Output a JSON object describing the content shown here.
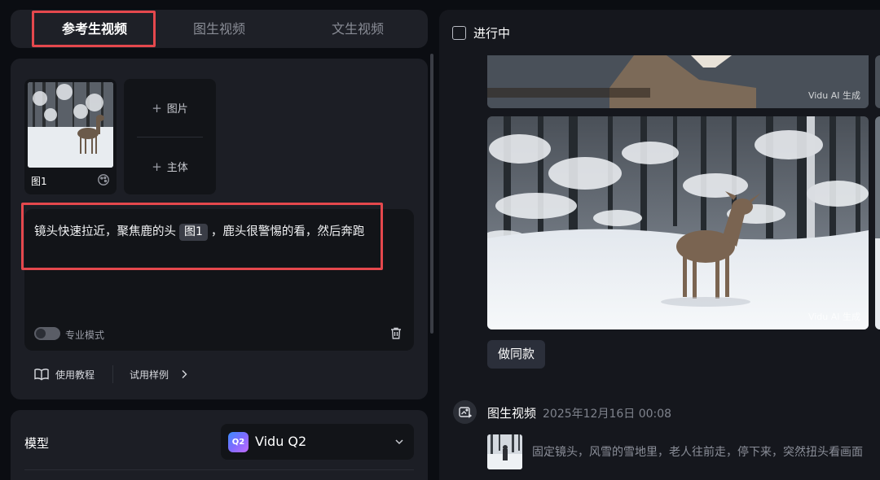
{
  "tabs": [
    {
      "label": "参考生视频",
      "active": true
    },
    {
      "label": "图生视频",
      "active": false
    },
    {
      "label": "文生视频",
      "active": false
    }
  ],
  "reference": {
    "image_label": "图1",
    "add_image_label": "图片",
    "add_subject_label": "主体"
  },
  "prompt": {
    "text_before": "镜头快速拉近，聚焦鹿的头",
    "chip": "图1",
    "text_after": "，鹿头很警惕的看，然后奔跑"
  },
  "pro_mode": {
    "label": "专业模式",
    "enabled": false
  },
  "help": {
    "tutorial_label": "使用教程",
    "samples_label": "试用样例"
  },
  "model": {
    "label": "模型",
    "logo_text": "Q2",
    "selected": "Vidu Q2"
  },
  "results": {
    "in_progress_label": "进行中",
    "watermark": "Vidu AI 生成",
    "same_button": "做同款"
  },
  "task": {
    "type": "图生视频",
    "time": "2025年12月16日 00:08",
    "prompt": "固定镜头，风雪的雪地里，老人往前走，停下来，突然扭头看画面"
  },
  "colors": {
    "highlight": "#e5484d",
    "background": "#0b0d12",
    "panel": "#1c1e25"
  }
}
